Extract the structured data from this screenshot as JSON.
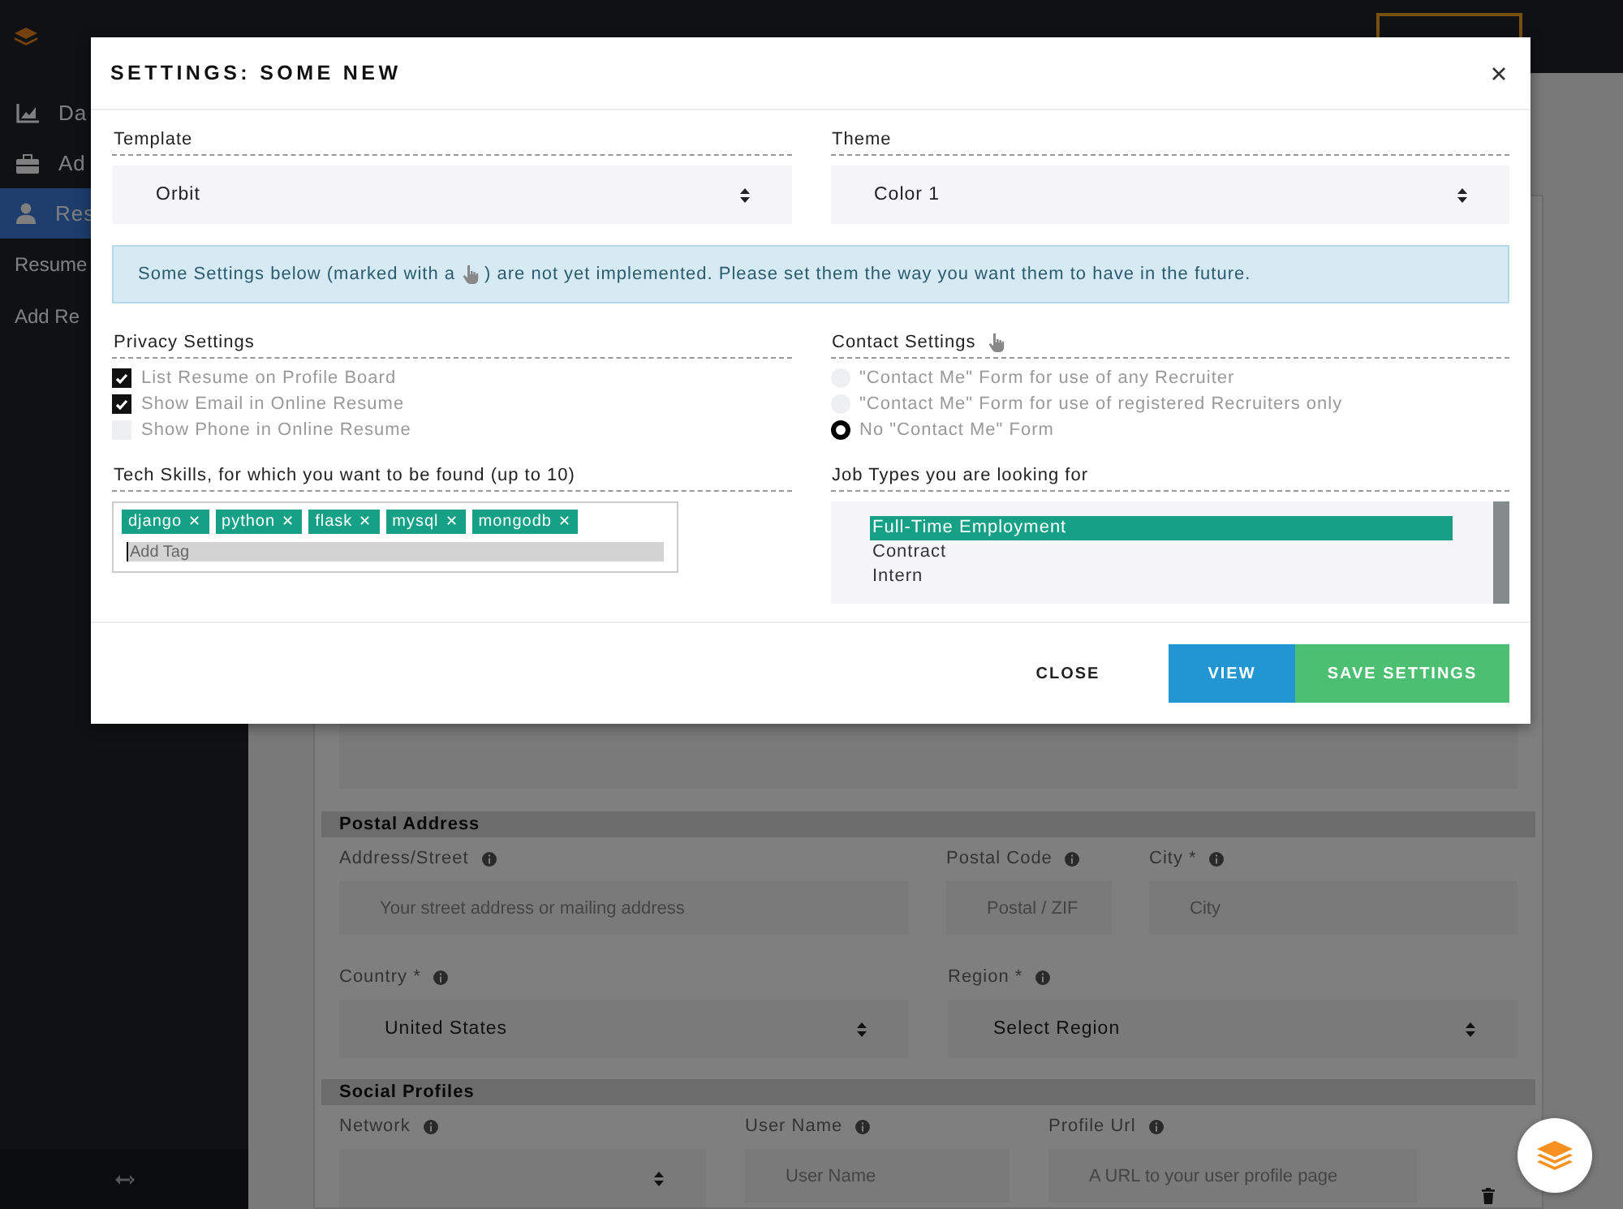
{
  "sidebar": {
    "items": [
      {
        "label": "Da",
        "selected": false
      },
      {
        "label": "Ad",
        "selected": false
      },
      {
        "label": "Res",
        "selected": true
      }
    ],
    "links": [
      "Resume",
      "Add Re"
    ]
  },
  "background_form": {
    "postal": {
      "title": "Postal Address",
      "street": {
        "label": "Address/Street",
        "placeholder": "Your street address or mailing address"
      },
      "postal_code": {
        "label": "Postal Code",
        "placeholder": "Postal / ZIF"
      },
      "city": {
        "label": "City *",
        "placeholder": "City"
      },
      "country": {
        "label": "Country *",
        "value": "United States"
      },
      "region": {
        "label": "Region *",
        "value": "Select Region"
      }
    },
    "social": {
      "title": "Social Profiles",
      "network": {
        "label": "Network"
      },
      "user_name": {
        "label": "User Name",
        "placeholder": "User Name"
      },
      "profile_url": {
        "label": "Profile Url",
        "placeholder": "A URL to your user profile page"
      }
    }
  },
  "modal": {
    "title": "SETTINGS: SOME NEW",
    "template": {
      "label": "Template",
      "value": "Orbit"
    },
    "theme": {
      "label": "Theme",
      "value": "Color 1"
    },
    "alert": {
      "before": "Some Settings below (marked with a",
      "after": ") are not yet implemented. Please set them the way you want them to have in the future."
    },
    "privacy": {
      "label": "Privacy Settings",
      "options": [
        {
          "label": "List Resume on Profile Board",
          "checked": true
        },
        {
          "label": "Show Email in Online Resume",
          "checked": true
        },
        {
          "label": "Show Phone in Online Resume",
          "checked": false
        }
      ]
    },
    "contact": {
      "label": "Contact Settings",
      "options": [
        {
          "label": "\"Contact Me\" Form for use of any Recruiter",
          "selected": false
        },
        {
          "label": "\"Contact Me\" Form for use of registered Recruiters only",
          "selected": false
        },
        {
          "label": "No \"Contact Me\" Form",
          "selected": true
        }
      ]
    },
    "skills": {
      "label": "Tech Skills, for which you want to be found (up to 10)",
      "tags": [
        {
          "label": "django",
          "remove": "✕"
        },
        {
          "label": "python",
          "remove": "✕"
        },
        {
          "label": "flask",
          "remove": "✕"
        },
        {
          "label": "mysql",
          "remove": "✕"
        },
        {
          "label": "mongodb",
          "remove": "✕"
        }
      ],
      "placeholder": "Add Tag"
    },
    "job_types": {
      "label": "Job Types you are looking for",
      "options": [
        {
          "label": "Full-Time Employment",
          "selected": true
        },
        {
          "label": "Contract",
          "selected": false
        },
        {
          "label": "Intern",
          "selected": false
        }
      ]
    },
    "buttons": [
      {
        "label": "CLOSE",
        "kind": "close"
      },
      {
        "label": "VIEW",
        "kind": "view"
      },
      {
        "label": "SAVE SETTINGS",
        "kind": "save"
      }
    ]
  }
}
